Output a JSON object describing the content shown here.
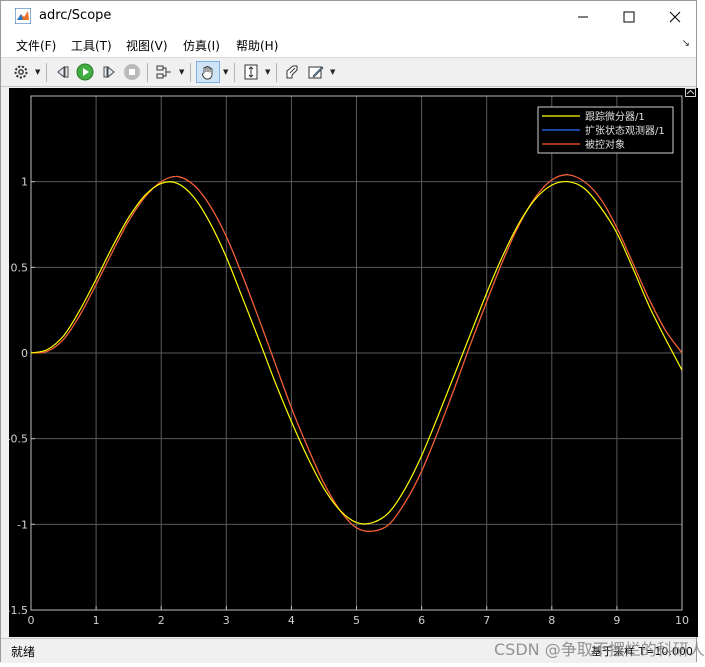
{
  "window": {
    "title": "adrc/Scope",
    "minimize_symbol": "—",
    "restore_symbol": "☐",
    "close_symbol": "✕"
  },
  "menu": {
    "items": [
      "文件(F)",
      "工具(T)",
      "视图(V)",
      "仿真(I)",
      "帮助(H)"
    ],
    "right_glyph": "↘"
  },
  "toolbar": {
    "icons": [
      "gear-icon",
      "step-back-icon",
      "run-icon",
      "step-forward-icon",
      "stop-icon",
      "signal-selector-icon",
      "zoom-pan-icon",
      "autoscale-icon",
      "highlight-icon",
      "style-icon"
    ]
  },
  "status": {
    "left": "就绪",
    "right": "基于采样 T=10.000"
  },
  "watermark": "CSDN @争取不摆烂的科研人",
  "colors": {
    "background": "#000000",
    "grid": "#5a5a5a",
    "axis_text": "#d0d0d0",
    "tracking": "#ffff00",
    "eso": "#2f6cff",
    "plant": "#ff5a1e"
  },
  "chart_data": {
    "type": "line",
    "xlim": [
      0,
      10
    ],
    "ylim": [
      -1.5,
      1.5
    ],
    "xticks": [
      "0",
      "1",
      "2",
      "3",
      "4",
      "5",
      "6",
      "7",
      "8",
      "9",
      "10"
    ],
    "yticks": [
      "1",
      "0.5",
      "0",
      "-0.5",
      "-1",
      "-1.5"
    ],
    "ytick_values": [
      1,
      0.5,
      0,
      -0.5,
      -1,
      -1.5
    ],
    "grid": true,
    "legend_position": "top-right",
    "series": [
      {
        "name": "跟踪微分器/1",
        "color": "#ffff00",
        "x": [
          0,
          0.25,
          0.5,
          0.75,
          1,
          1.25,
          1.5,
          1.75,
          2,
          2.25,
          2.5,
          2.75,
          3,
          3.25,
          3.5,
          3.75,
          4,
          4.25,
          4.5,
          4.75,
          5,
          5.25,
          5.5,
          5.75,
          6,
          6.25,
          6.5,
          6.75,
          7,
          7.25,
          7.5,
          7.75,
          8,
          8.25,
          8.5,
          8.75,
          9,
          9.25,
          9.5,
          9.75,
          10
        ],
        "y": [
          0,
          0.02,
          0.1,
          0.25,
          0.43,
          0.62,
          0.79,
          0.92,
          0.99,
          0.99,
          0.91,
          0.76,
          0.56,
          0.32,
          0.08,
          -0.17,
          -0.4,
          -0.61,
          -0.79,
          -0.92,
          -0.99,
          -0.99,
          -0.93,
          -0.79,
          -0.6,
          -0.37,
          -0.13,
          0.11,
          0.35,
          0.57,
          0.76,
          0.9,
          0.98,
          1.0,
          0.96,
          0.85,
          0.7,
          0.49,
          0.27,
          0.08,
          -0.1
        ]
      },
      {
        "name": "扩张状态观测器/1",
        "color": "#2f6cff",
        "x": [
          0,
          0.25,
          0.5,
          0.75,
          1,
          1.25,
          1.5,
          1.75,
          2,
          2.25,
          2.5,
          2.75,
          3,
          3.25,
          3.5,
          3.75,
          4,
          4.25,
          4.5,
          4.75,
          5,
          5.25,
          5.5,
          5.75,
          6,
          6.25,
          6.5,
          6.75,
          7,
          7.25,
          7.5,
          7.75,
          8,
          8.25,
          8.5,
          8.75,
          9,
          9.25,
          9.5,
          9.75,
          10
        ],
        "y": [
          0,
          0.01,
          0.08,
          0.22,
          0.4,
          0.59,
          0.77,
          0.91,
          1.0,
          1.03,
          0.98,
          0.86,
          0.68,
          0.45,
          0.2,
          -0.06,
          -0.32,
          -0.55,
          -0.76,
          -0.92,
          -1.02,
          -1.04,
          -1.0,
          -0.87,
          -0.69,
          -0.46,
          -0.21,
          0.05,
          0.3,
          0.54,
          0.75,
          0.91,
          1.01,
          1.04,
          1.0,
          0.9,
          0.73,
          0.52,
          0.31,
          0.13,
          0.0
        ]
      },
      {
        "name": "被控对象",
        "color": "#ff5a1e",
        "x": [
          0,
          0.25,
          0.5,
          0.75,
          1,
          1.25,
          1.5,
          1.75,
          2,
          2.25,
          2.5,
          2.75,
          3,
          3.25,
          3.5,
          3.75,
          4,
          4.25,
          4.5,
          4.75,
          5,
          5.25,
          5.5,
          5.75,
          6,
          6.25,
          6.5,
          6.75,
          7,
          7.25,
          7.5,
          7.75,
          8,
          8.25,
          8.5,
          8.75,
          9,
          9.25,
          9.5,
          9.75,
          10
        ],
        "y": [
          0,
          0.01,
          0.08,
          0.22,
          0.4,
          0.59,
          0.77,
          0.91,
          1.0,
          1.03,
          0.98,
          0.86,
          0.68,
          0.45,
          0.2,
          -0.06,
          -0.32,
          -0.55,
          -0.76,
          -0.92,
          -1.02,
          -1.04,
          -1.0,
          -0.87,
          -0.69,
          -0.46,
          -0.21,
          0.05,
          0.3,
          0.54,
          0.75,
          0.91,
          1.01,
          1.04,
          1.0,
          0.9,
          0.73,
          0.52,
          0.31,
          0.13,
          0.0
        ]
      }
    ]
  }
}
